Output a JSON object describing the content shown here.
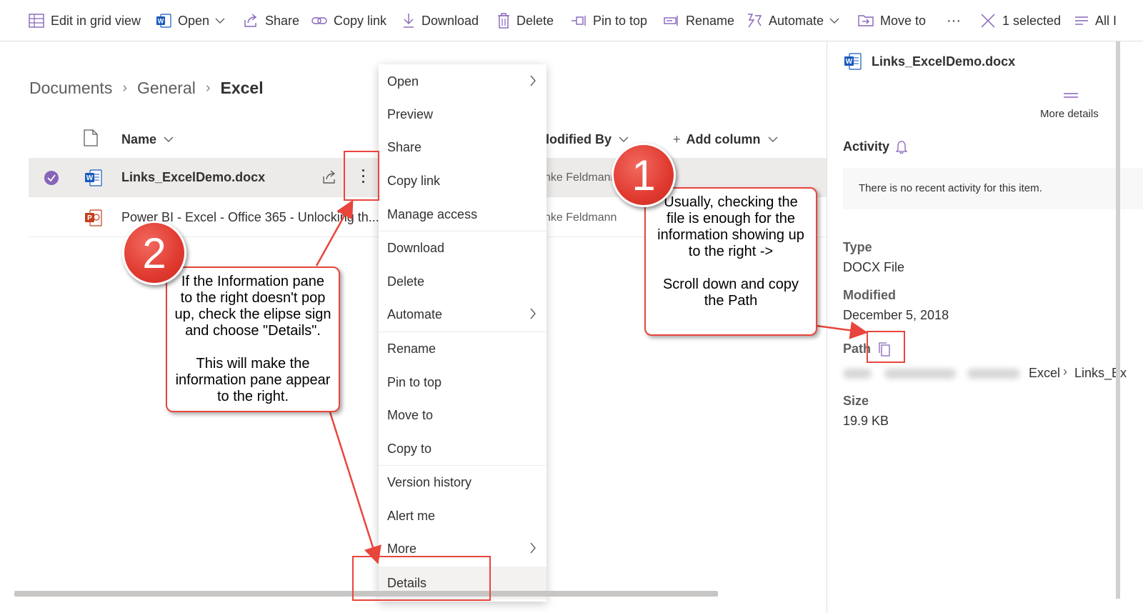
{
  "toolbar": {
    "edit_grid": "Edit in grid view",
    "open": "Open",
    "share": "Share",
    "copy_link": "Copy link",
    "download": "Download",
    "delete": "Delete",
    "pin_to_top": "Pin to top",
    "rename": "Rename",
    "automate": "Automate",
    "move_to": "Move to",
    "more": "···",
    "selected": "1 selected",
    "all": "All I"
  },
  "breadcrumb": {
    "items": [
      "Documents",
      "General"
    ],
    "current": "Excel"
  },
  "list": {
    "columns": {
      "name": "Name",
      "modified_by": "lodified By",
      "add_column": "Add column"
    },
    "rows": [
      {
        "name": "Links_ExcelDemo.docx",
        "modified_by": "nke Feldmann",
        "selected": true
      },
      {
        "name": "Power BI - Excel - Office 365 - Unlocking th...",
        "modified_by": "nke Feldmann",
        "selected": false
      }
    ]
  },
  "context_menu": {
    "items": [
      "Open",
      "Preview",
      "Share",
      "Copy link",
      "Manage access",
      "Download",
      "Delete",
      "Automate",
      "Rename",
      "Pin to top",
      "Move to",
      "Copy to",
      "Version history",
      "Alert me",
      "More",
      "Details"
    ]
  },
  "pane": {
    "file_name": "Links_ExcelDemo.docx",
    "more_details": "More details",
    "activity_label": "Activity",
    "activity_text": "There is no recent activity for this item.",
    "type_label": "Type",
    "type_value": "DOCX File",
    "modified_label": "Modified",
    "modified_value": "December 5, 2018",
    "path_label": "Path",
    "path_tail_1": "Excel",
    "path_tail_2": "Links_Ex",
    "size_label": "Size",
    "size_value": "19.9 KB"
  },
  "callouts": {
    "badge1": "1",
    "badge2": "2",
    "callout1_lines": [
      "Usually, checking the",
      "file is enough for the",
      "information showing up",
      "to the right ->",
      "",
      "Scroll down and copy",
      "the Path"
    ],
    "callout2_lines": [
      "If the Information pane",
      "to the right doesn't pop",
      "up, check the elipse sign",
      "and choose \"Details\".",
      "",
      "This will make the",
      "information pane appear",
      "to the right."
    ]
  },
  "colors": {
    "accent": "#8764b8",
    "annotation_red": "#e8453c",
    "word_blue": "#185abd",
    "ppt_red": "#c43e1c"
  }
}
